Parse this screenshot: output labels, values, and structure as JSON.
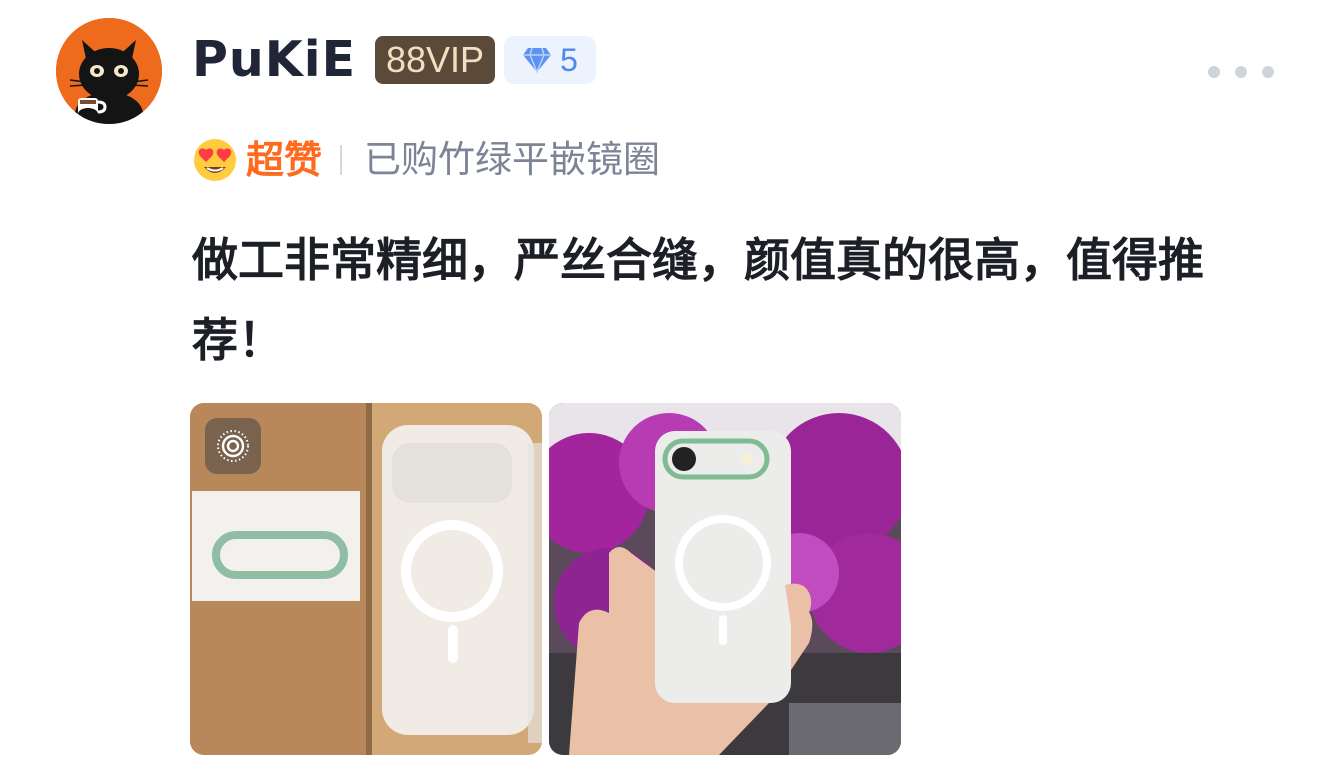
{
  "user": {
    "name": "PuKiE",
    "vip_badge": "88VIP",
    "level": "5"
  },
  "rating": {
    "label": "超赞",
    "purchased_spec": "已购竹绿平嵌镜圈"
  },
  "review": {
    "text": "做工非常精细，严丝合缝，颜值真的很高，值得推荐！"
  },
  "icons": {
    "more": "more-dots-icon",
    "level": "diamond-icon",
    "rating": "heart-eyes-emoji-icon",
    "live_photo": "live-photo-icon"
  },
  "colors": {
    "avatar_bg": "#ee6a1d",
    "rating_orange": "#ff6a1f",
    "level_blue": "#4e88ef",
    "vip_bg": "#5b4a39",
    "vip_text": "#f3dfc0",
    "muted_text": "#7d8496"
  }
}
